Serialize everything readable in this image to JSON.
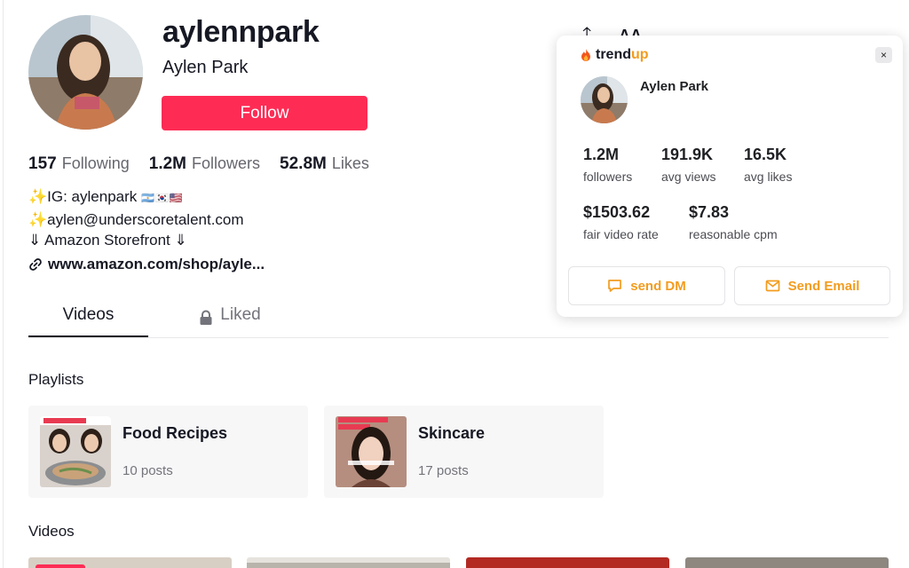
{
  "profile": {
    "username": "aylennpark",
    "display_name": "Aylen Park",
    "follow_label": "Follow",
    "stats": [
      {
        "value": "157",
        "label": "Following"
      },
      {
        "value": "1.2M",
        "label": "Followers"
      },
      {
        "value": "52.8M",
        "label": "Likes"
      }
    ],
    "bio": {
      "line1_prefix": "✨IG: aylenpark",
      "line1_flags": "🇦🇷🇰🇷🇺🇸",
      "line2": "✨aylen@underscoretalent.com",
      "line3": "⇓ Amazon Storefront ⇓"
    },
    "link": "www.amazon.com/shop/ayle..."
  },
  "tabs": {
    "videos": "Videos",
    "liked": "Liked"
  },
  "playlists_title": "Playlists",
  "playlists": [
    {
      "title": "Food Recipes",
      "count": "10 posts"
    },
    {
      "title": "Skincare",
      "count": "17 posts"
    }
  ],
  "videos_title": "Videos",
  "header_stub": {
    "share_glyph": "⍏",
    "more_text": "AA"
  },
  "trendup": {
    "brand_trend": "trend",
    "brand_up": "up",
    "close": "×",
    "name": "Aylen Park",
    "metrics": [
      {
        "value": "1.2M",
        "label": "followers"
      },
      {
        "value": "191.9K",
        "label": "avg views"
      },
      {
        "value": "16.5K",
        "label": "avg likes"
      },
      {
        "value": "$1503.62",
        "label": "fair video rate"
      },
      {
        "value": "$7.83",
        "label": "reasonable cpm"
      }
    ],
    "send_dm": "send DM",
    "send_email": "Send Email"
  },
  "colors": {
    "follow": "#fe2c55",
    "accent": "#f39c1f",
    "text": "#161823",
    "muted": "#73747b"
  }
}
